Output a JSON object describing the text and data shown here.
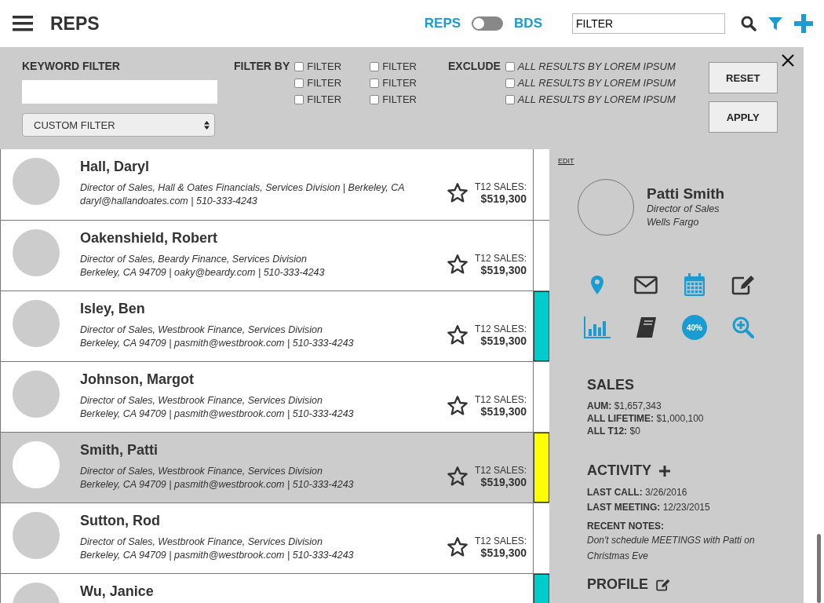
{
  "header": {
    "title": "REPS",
    "toggle": {
      "left": "REPS",
      "right": "BDS",
      "on": false
    },
    "search": {
      "value": "FILTER"
    }
  },
  "filter_panel": {
    "keyword_label": "KEYWORD FILTER",
    "dropdown": "CUSTOM FILTER",
    "filter_by_label": "FILTER BY",
    "filter_by": [
      {
        "label": "FILTER",
        "checked": false
      },
      {
        "label": "FILTER",
        "checked": false
      },
      {
        "label": "FILTER",
        "checked": false
      },
      {
        "label": "FILTER",
        "checked": false
      },
      {
        "label": "FILTER",
        "checked": false
      },
      {
        "label": "FILTER",
        "checked": false
      }
    ],
    "exclude_label": "EXCLUDE",
    "exclude": [
      {
        "label": "ALL RESULTS BY LOREM IPSUM",
        "checked": false
      },
      {
        "label": "ALL RESULTS BY LOREM IPSUM",
        "checked": false
      },
      {
        "label": "ALL RESULTS BY LOREM IPSUM",
        "checked": false
      }
    ],
    "buttons": [
      "RESET",
      "APPLY"
    ]
  },
  "reps": [
    {
      "name": "Hall, Daryl",
      "line1": "Director of Sales, Hall & Oates Financials, Services Division | Berkeley, CA",
      "line2": "daryl@hallandoates.com | 510-333-4243",
      "sales_label": "T12 SALES:",
      "sales": "$519,300",
      "selected": false
    },
    {
      "name": "Oakenshield, Robert",
      "line1": "Director of Sales, Beardy Finance, Services Division",
      "line2": "Berkeley, CA 94709  |  oaky@beardy.com | 510-333-4243",
      "sales_label": "T12 SALES:",
      "sales": "$519,300",
      "selected": false
    },
    {
      "name": "Isley, Ben",
      "line1": "Director of Sales, Westbrook Finance, Services Division",
      "line2": "Berkeley, CA 94709  |  pasmith@westbrook.com | 510-333-4243",
      "sales_label": "T12 SALES:",
      "sales": "$519,300",
      "selected": false,
      "color": "#00cccc"
    },
    {
      "name": "Johnson, Margot",
      "line1": "Director of Sales, Westbrook Finance, Services Division",
      "line2": "Berkeley, CA 94709  |  pasmith@westbrook.com | 510-333-4243",
      "sales_label": "T12 SALES:",
      "sales": "$519,300",
      "selected": false
    },
    {
      "name": "Smith, Patti",
      "line1": "Director of Sales, Westbrook Finance, Services Division",
      "line2": "Berkeley, CA 94709  |  pasmith@westbrook.com | 510-333-4243",
      "sales_label": "T12 SALES:",
      "sales": "$519,300",
      "selected": true,
      "color": "#ffff00"
    },
    {
      "name": "Sutton, Rod",
      "line1": "Director of Sales, Westbrook Finance, Services Division",
      "line2": "Berkeley, CA 94709  |  pasmith@westbrook.com | 510-333-4243",
      "sales_label": "T12 SALES:",
      "sales": "$519,300",
      "selected": false
    },
    {
      "name": "Wu, Janice",
      "selected": false,
      "color": "#00cccc"
    }
  ],
  "detail": {
    "edit": "EDIT",
    "name": "Patti Smith",
    "title": "Director of Sales",
    "company": "Wells Fargo",
    "percent": "40%",
    "sales_heading": "SALES",
    "sales": [
      {
        "label": "AUM:",
        "value": "$1,657,343"
      },
      {
        "label": "ALL LIFETIME:",
        "value": "$1,000,100"
      },
      {
        "label": "ALL T12:",
        "value": "$0"
      }
    ],
    "activity_heading": "ACTIVITY",
    "activity": [
      {
        "label": "LAST CALL:",
        "value": "3/26/2016"
      },
      {
        "label": "LAST MEETING:",
        "value": "12/23/2015"
      }
    ],
    "notes_label": "RECENT NOTES:",
    "notes": "Don't schedule MEETINGS with Patti on Christmas Eve",
    "profile_heading": "PROFILE"
  }
}
